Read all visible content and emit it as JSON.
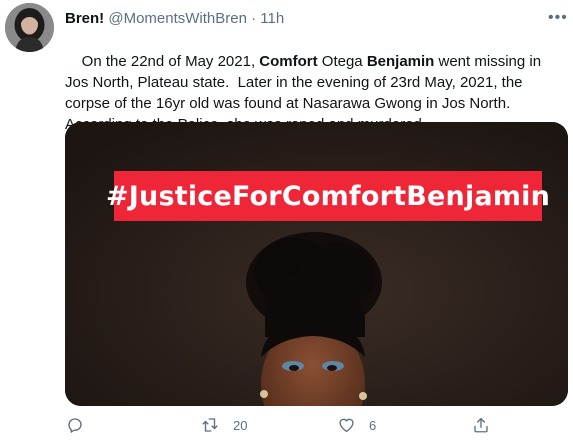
{
  "user": {
    "display_name": "Bren!",
    "handle": "@MomentsWithBren",
    "separator": "·",
    "time": "11h"
  },
  "tweet": {
    "segments": [
      {
        "text": "On the 22nd of May 2021, ",
        "bold": false
      },
      {
        "text": "Comfort",
        "bold": true
      },
      {
        "text": " Otega ",
        "bold": false
      },
      {
        "text": "Benjamin",
        "bold": true
      },
      {
        "text": " went missing in Jos North, Plateau state.  Later in the evening of 23rd May, 2021, the corpse of the 16yr old was found at Nasarawa Gwong in Jos North. According to the Police, she was raped and murdered.",
        "bold": false
      }
    ]
  },
  "media": {
    "banner_text": "#JusticeForComfortBenjamin",
    "banner_color": "#ee2638"
  },
  "actions": {
    "reply_icon": "reply-icon",
    "retweet_icon": "retweet-icon",
    "retweet_count": "20",
    "like_icon": "heart-icon",
    "like_count": "6",
    "share_icon": "share-icon"
  },
  "colors": {
    "text": "#0f1419",
    "secondary": "#5b7083",
    "background": "#ffffff"
  }
}
